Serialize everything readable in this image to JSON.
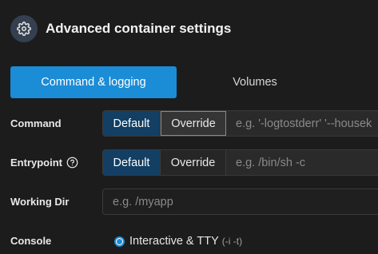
{
  "header": {
    "icon": "gear-icon",
    "title": "Advanced container settings"
  },
  "tabs": [
    {
      "label": "Command & logging",
      "active": true
    },
    {
      "label": "Volumes",
      "active": false
    }
  ],
  "command": {
    "label": "Command",
    "options": [
      "Default",
      "Override"
    ],
    "selected": "Override",
    "placeholder": "e.g. '-logtostderr' '--housek"
  },
  "entrypoint": {
    "label": "Entrypoint",
    "help_icon": "question-circle-icon",
    "options": [
      "Default",
      "Override"
    ],
    "selected": "Default",
    "placeholder": "e.g. /bin/sh -c"
  },
  "working_dir": {
    "label": "Working Dir",
    "placeholder": "e.g. /myapp"
  },
  "console": {
    "label": "Console",
    "option_label": "Interactive & TTY",
    "option_hint": "(-i -t)"
  },
  "colors": {
    "accent": "#1b8cd6",
    "selected_segment": "#123f63",
    "background": "#1c1c1c"
  }
}
